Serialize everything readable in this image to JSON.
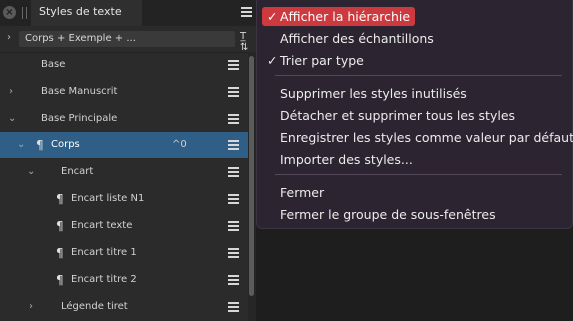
{
  "panel": {
    "tab_close": "×",
    "tab_title": "Styles de texte",
    "filter": {
      "value": "Corps + Exemple + ...",
      "chevron": "›",
      "icon": "T̲ ⇅"
    },
    "rows": [
      {
        "label": "Base",
        "expander": "",
        "para": "",
        "shortcut": ""
      },
      {
        "label": "Base Manuscrit",
        "expander": "›",
        "para": "",
        "shortcut": ""
      },
      {
        "label": "Base Principale",
        "expander": "⌄",
        "para": "",
        "shortcut": ""
      },
      {
        "label": "Corps",
        "expander": "⌄",
        "para": "¶",
        "shortcut": "^0",
        "selected": true
      },
      {
        "label": "Encart",
        "expander": "⌄",
        "para": "",
        "shortcut": ""
      },
      {
        "label": "Encart liste N1",
        "expander": "",
        "para": "¶",
        "shortcut": ""
      },
      {
        "label": "Encart texte",
        "expander": "",
        "para": "¶",
        "shortcut": ""
      },
      {
        "label": "Encart titre 1",
        "expander": "",
        "para": "¶",
        "shortcut": ""
      },
      {
        "label": "Encart titre 2",
        "expander": "",
        "para": "¶",
        "shortcut": ""
      },
      {
        "label": "Légende tiret",
        "expander": "›",
        "para": "",
        "shortcut": ""
      }
    ]
  },
  "menu": {
    "items": [
      {
        "label": "Afficher la hiérarchie",
        "check": "✓",
        "highlighted": true
      },
      {
        "label": "Afficher des échantillons",
        "check": ""
      },
      {
        "label": "Trier par type",
        "check": "✓"
      },
      {
        "label": "Supprimer les styles inutilisés",
        "check": ""
      },
      {
        "label": "Détacher et supprimer tous les styles",
        "check": ""
      },
      {
        "label": "Enregistrer les styles comme valeur par défaut",
        "check": ""
      },
      {
        "label": "Importer des styles...",
        "check": ""
      },
      {
        "label": "Fermer",
        "check": ""
      },
      {
        "label": "Fermer le groupe de sous-fenêtres",
        "check": ""
      }
    ]
  },
  "colors": {
    "selection": "#2f5f86",
    "menu_highlight": "#cc3a3f",
    "menu_bg": "#2c2531"
  }
}
